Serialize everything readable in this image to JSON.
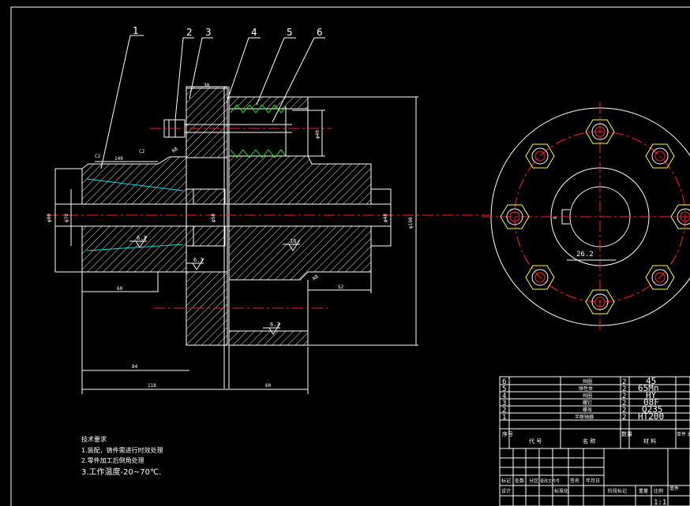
{
  "balloons": [
    "1",
    "2",
    "3",
    "4",
    "5",
    "6"
  ],
  "dims": {
    "d30": "30",
    "d140": "140",
    "d60a": "60",
    "d84": "84",
    "d118": "118",
    "d60b": "60",
    "d52": "52",
    "d26": "26.2",
    "d8": "8",
    "phi80": "φ80",
    "phi70": "φ70",
    "phi50": "φ50",
    "phi48": "φ48",
    "phi190": "φ190",
    "phi40": "φ40",
    "r8": "R8",
    "r8b": "R8",
    "c2a": "C2",
    "c2b": "C2"
  },
  "roughness": {
    "r1": "6.3",
    "r2": "6.3",
    "r3": "16",
    "r4": "6.3"
  },
  "notes": {
    "title": "技术要求",
    "lines": [
      "1.装配，铸件需进行时效处理",
      "2.零件加工后倒角处理",
      "3.工作温度-20~70℃."
    ]
  },
  "bom": {
    "rows": [
      {
        "no": "6",
        "code": "",
        "name": "挡圈",
        "qty": "2",
        "material": "45"
      },
      {
        "no": "5",
        "code": "",
        "name": "弹性体",
        "qty": "2",
        "material": "65Mn"
      },
      {
        "no": "4",
        "code": "",
        "name": "挡圈",
        "qty": "2",
        "material": "HY"
      },
      {
        "no": "3",
        "code": "",
        "name": "螺钉",
        "qty": "2",
        "material": "08F"
      },
      {
        "no": "2",
        "code": "",
        "name": "螺母",
        "qty": "2",
        "material": "Q235"
      },
      {
        "no": "1",
        "code": "",
        "name": "半联轴器",
        "qty": "2",
        "material": "HT200"
      }
    ],
    "header": {
      "no": "序号",
      "code": "代 号",
      "name": "名 称",
      "qty": "数量",
      "material": "材 料",
      "extra": "单件 总计"
    }
  },
  "titleblock": {
    "labels": [
      "标记",
      "处数",
      "分区",
      "更改文件号",
      "签名",
      "年月日"
    ],
    "design": "设计",
    "std": "标准化",
    "stage": "阶段标记",
    "weight": "重量",
    "scale": "比例",
    "scale_value": "1:1",
    "unit": "单件"
  }
}
